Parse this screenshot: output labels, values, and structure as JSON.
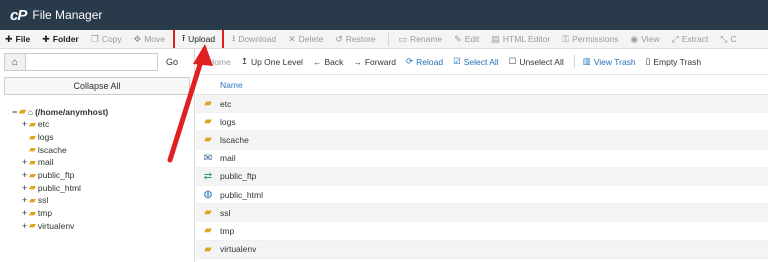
{
  "header": {
    "logo": "cP",
    "title": "File Manager"
  },
  "toolbar": {
    "file": "File",
    "folder": "Folder",
    "copy": "Copy",
    "move": "Move",
    "upload": "Upload",
    "download": "Download",
    "delete": "Delete",
    "restore": "Restore",
    "rename": "Rename",
    "edit": "Edit",
    "html_editor": "HTML Editor",
    "permissions": "Permissions",
    "view": "View",
    "extract": "Extract",
    "compress": "C"
  },
  "left": {
    "go": "Go",
    "collapse_all": "Collapse All",
    "root": "(/home/anymhost)",
    "tree": [
      "etc",
      "logs",
      "lscache",
      "mail",
      "public_ftp",
      "public_html",
      "ssl",
      "tmp",
      "virtualenv"
    ]
  },
  "nav": {
    "home": "Home",
    "up": "Up One Level",
    "back": "Back",
    "forward": "Forward",
    "reload": "Reload",
    "select_all": "Select All",
    "unselect_all": "Unselect All",
    "view_trash": "View Trash",
    "empty_trash": "Empty Trash"
  },
  "files": {
    "column_name": "Name",
    "rows": [
      "etc",
      "logs",
      "lscache",
      "mail",
      "public_ftp",
      "public_html",
      "ssl",
      "tmp",
      "virtualenv"
    ]
  },
  "colors": {
    "header_bg": "#293a4a",
    "highlight": "#e02020",
    "link": "#1f6fb8",
    "folder": "#e2a321"
  }
}
